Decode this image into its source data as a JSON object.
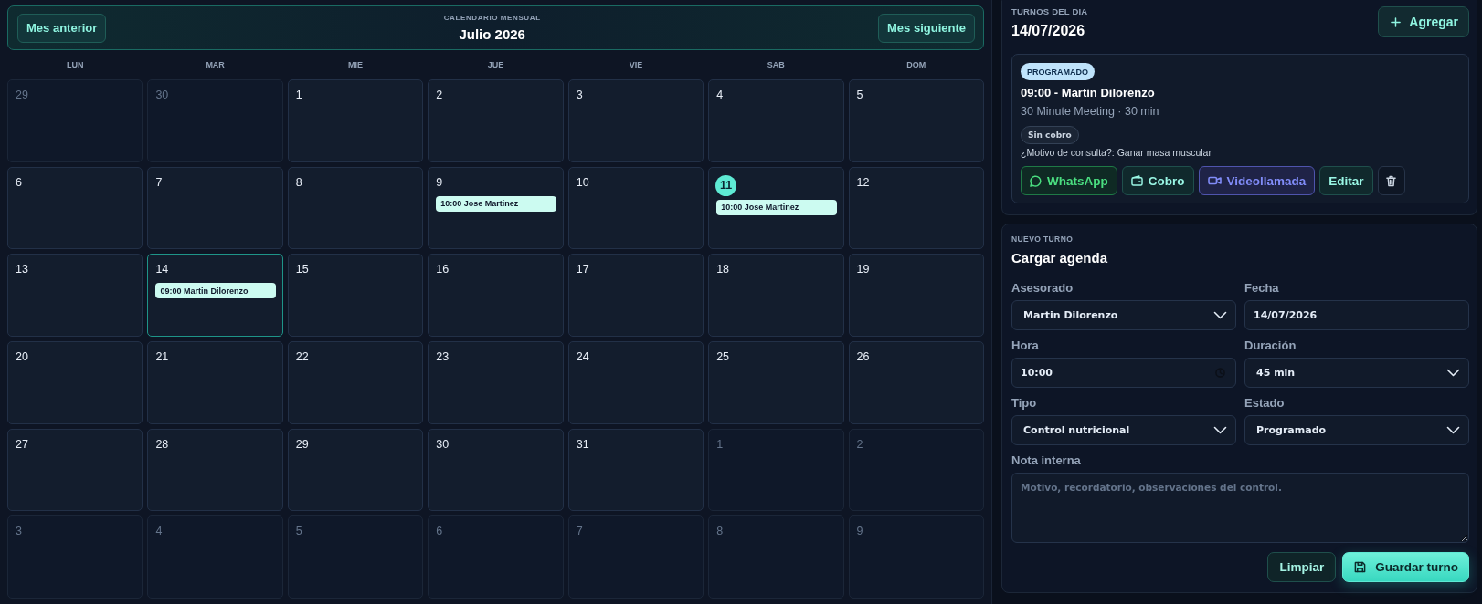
{
  "calendar": {
    "eyebrow": "CALENDARIO MENSUAL",
    "title": "Julio 2026",
    "prev_button": "Mes anterior",
    "next_button": "Mes siguiente",
    "weekdays": [
      "LUN",
      "MAR",
      "MIE",
      "JUE",
      "VIE",
      "SAB",
      "DOM"
    ],
    "days": [
      {
        "label": "29",
        "in_month": false,
        "today": false,
        "selected": false
      },
      {
        "label": "30",
        "in_month": false,
        "today": false,
        "selected": false
      },
      {
        "label": "1",
        "in_month": true,
        "today": false,
        "selected": false
      },
      {
        "label": "2",
        "in_month": true,
        "today": false,
        "selected": false
      },
      {
        "label": "3",
        "in_month": true,
        "today": false,
        "selected": false
      },
      {
        "label": "4",
        "in_month": true,
        "today": false,
        "selected": false
      },
      {
        "label": "5",
        "in_month": true,
        "today": false,
        "selected": false
      },
      {
        "label": "6",
        "in_month": true,
        "today": false,
        "selected": false
      },
      {
        "label": "7",
        "in_month": true,
        "today": false,
        "selected": false
      },
      {
        "label": "8",
        "in_month": true,
        "today": false,
        "selected": false
      },
      {
        "label": "9",
        "in_month": true,
        "today": false,
        "selected": false,
        "events": [
          "10:00 Jose Martinez"
        ]
      },
      {
        "label": "10",
        "in_month": true,
        "today": false,
        "selected": false
      },
      {
        "label": "11",
        "in_month": true,
        "today": true,
        "selected": false,
        "events": [
          "10:00 Jose Martinez"
        ]
      },
      {
        "label": "12",
        "in_month": true,
        "today": false,
        "selected": false
      },
      {
        "label": "13",
        "in_month": true,
        "today": false,
        "selected": false
      },
      {
        "label": "14",
        "in_month": true,
        "today": false,
        "selected": true,
        "events": [
          "09:00 Martin Dilorenzo"
        ]
      },
      {
        "label": "15",
        "in_month": true,
        "today": false,
        "selected": false
      },
      {
        "label": "16",
        "in_month": true,
        "today": false,
        "selected": false
      },
      {
        "label": "17",
        "in_month": true,
        "today": false,
        "selected": false
      },
      {
        "label": "18",
        "in_month": true,
        "today": false,
        "selected": false
      },
      {
        "label": "19",
        "in_month": true,
        "today": false,
        "selected": false
      },
      {
        "label": "20",
        "in_month": true,
        "today": false,
        "selected": false
      },
      {
        "label": "21",
        "in_month": true,
        "today": false,
        "selected": false
      },
      {
        "label": "22",
        "in_month": true,
        "today": false,
        "selected": false
      },
      {
        "label": "23",
        "in_month": true,
        "today": false,
        "selected": false
      },
      {
        "label": "24",
        "in_month": true,
        "today": false,
        "selected": false
      },
      {
        "label": "25",
        "in_month": true,
        "today": false,
        "selected": false
      },
      {
        "label": "26",
        "in_month": true,
        "today": false,
        "selected": false
      },
      {
        "label": "27",
        "in_month": true,
        "today": false,
        "selected": false
      },
      {
        "label": "28",
        "in_month": true,
        "today": false,
        "selected": false
      },
      {
        "label": "29",
        "in_month": true,
        "today": false,
        "selected": false
      },
      {
        "label": "30",
        "in_month": true,
        "today": false,
        "selected": false
      },
      {
        "label": "31",
        "in_month": true,
        "today": false,
        "selected": false
      },
      {
        "label": "1",
        "in_month": false,
        "today": false,
        "selected": false
      },
      {
        "label": "2",
        "in_month": false,
        "today": false,
        "selected": false
      },
      {
        "label": "3",
        "in_month": false,
        "today": false,
        "selected": false
      },
      {
        "label": "4",
        "in_month": false,
        "today": false,
        "selected": false
      },
      {
        "label": "5",
        "in_month": false,
        "today": false,
        "selected": false
      },
      {
        "label": "6",
        "in_month": false,
        "today": false,
        "selected": false
      },
      {
        "label": "7",
        "in_month": false,
        "today": false,
        "selected": false
      },
      {
        "label": "8",
        "in_month": false,
        "today": false,
        "selected": false
      },
      {
        "label": "9",
        "in_month": false,
        "today": false,
        "selected": false
      }
    ]
  },
  "day_panel": {
    "eyebrow": "TURNOS DEL DIA",
    "date": "14/07/2026",
    "add_button": "Agregar",
    "appointments": [
      {
        "status": "PROGRAMADO",
        "title": "09:00 - Martin Dilorenzo",
        "subtitle": "30 Minute Meeting · 30 min",
        "payment": "Sin cobro",
        "note": "¿Motivo de consulta?: Ganar masa muscular",
        "actions": [
          {
            "kind": "whatsapp",
            "label": "WhatsApp"
          },
          {
            "kind": "payment",
            "label": "Cobro"
          },
          {
            "kind": "video",
            "label": "Videollamada"
          },
          {
            "kind": "edit",
            "label": "Editar"
          },
          {
            "kind": "delete"
          }
        ]
      }
    ]
  },
  "form": {
    "eyebrow": "NUEVO TURNO",
    "title": "Cargar agenda",
    "fields": [
      {
        "kind": "select",
        "label": "Asesorado",
        "value": "Martin Dilorenzo"
      },
      {
        "kind": "date",
        "label": "Fecha",
        "value": "14/07/2026"
      },
      {
        "kind": "time",
        "label": "Hora",
        "value": "10:00"
      },
      {
        "kind": "select",
        "label": "Duración",
        "value": "45 min"
      },
      {
        "kind": "select",
        "label": "Tipo",
        "value": "Control nutricional"
      },
      {
        "kind": "select",
        "label": "Estado",
        "value": "Programado"
      },
      {
        "kind": "textarea",
        "label": "Nota interna",
        "placeholder": "Motivo, recordatorio, observaciones del control."
      }
    ],
    "buttons": [
      {
        "kind": "secondary",
        "label": "Limpiar"
      },
      {
        "kind": "primary",
        "label": "Guardar turno"
      }
    ]
  }
}
